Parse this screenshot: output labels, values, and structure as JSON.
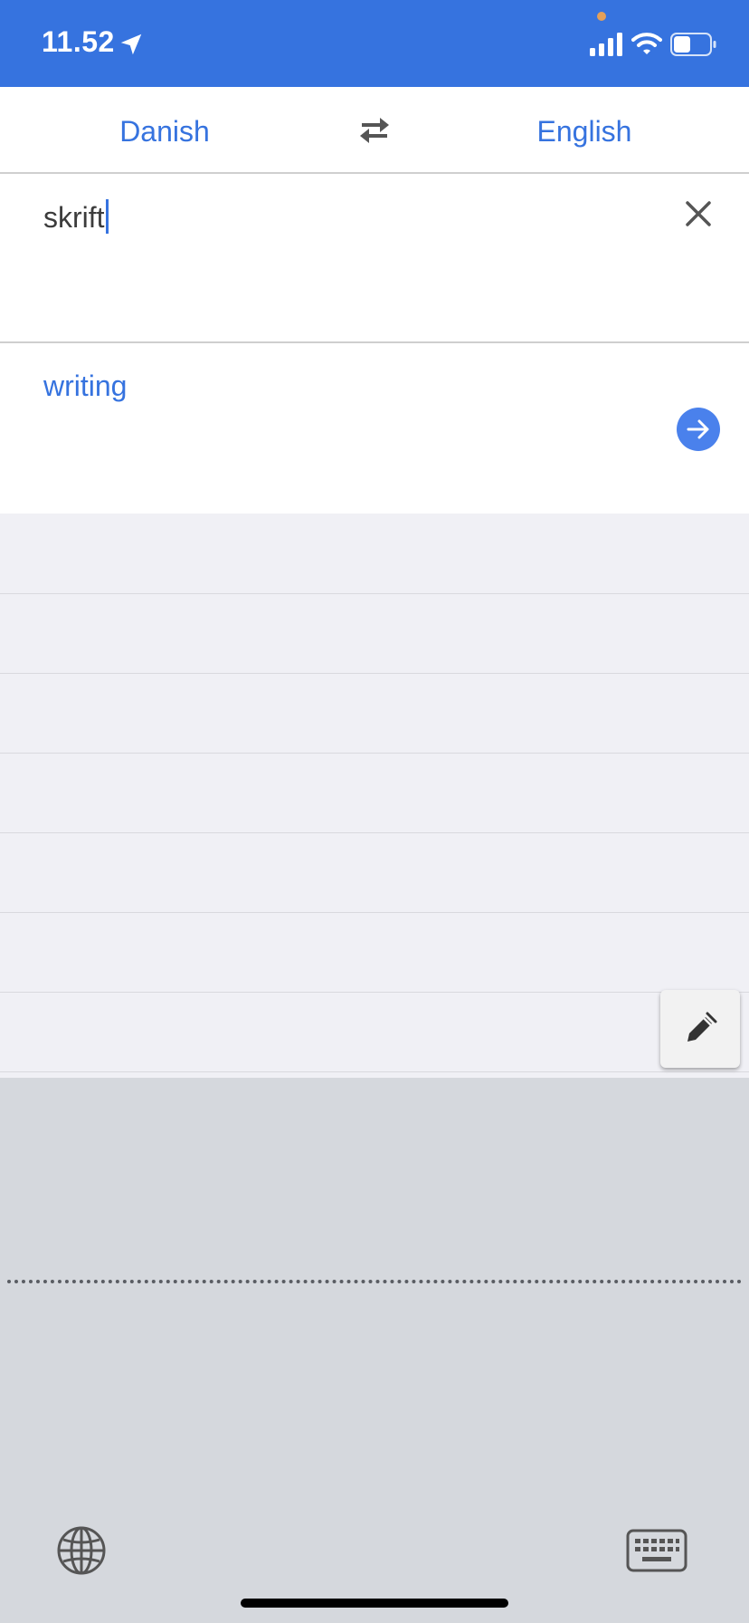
{
  "status_bar": {
    "time": "11.52",
    "location_icon": "location-arrow-icon",
    "privacy_dot_color": "#e3a05a",
    "signal_icon": "cellular-signal-icon",
    "wifi_icon": "wifi-icon",
    "battery_icon": "battery-icon",
    "background_color": "#3673df"
  },
  "language_bar": {
    "source_language": "Danish",
    "target_language": "English",
    "swap_icon": "swap-arrows-icon",
    "accent_color": "#3673df"
  },
  "input": {
    "value": "skrift",
    "clear_icon": "close-icon"
  },
  "translation": {
    "text": "writing",
    "open_icon": "arrow-right-circle-icon"
  },
  "history_list": {
    "background_color": "#f0f0f5"
  },
  "handwriting": {
    "pen_icon": "pen-icon",
    "globe_icon": "globe-icon",
    "keyboard_icon": "keyboard-icon",
    "background_color": "#d5d8dd"
  }
}
